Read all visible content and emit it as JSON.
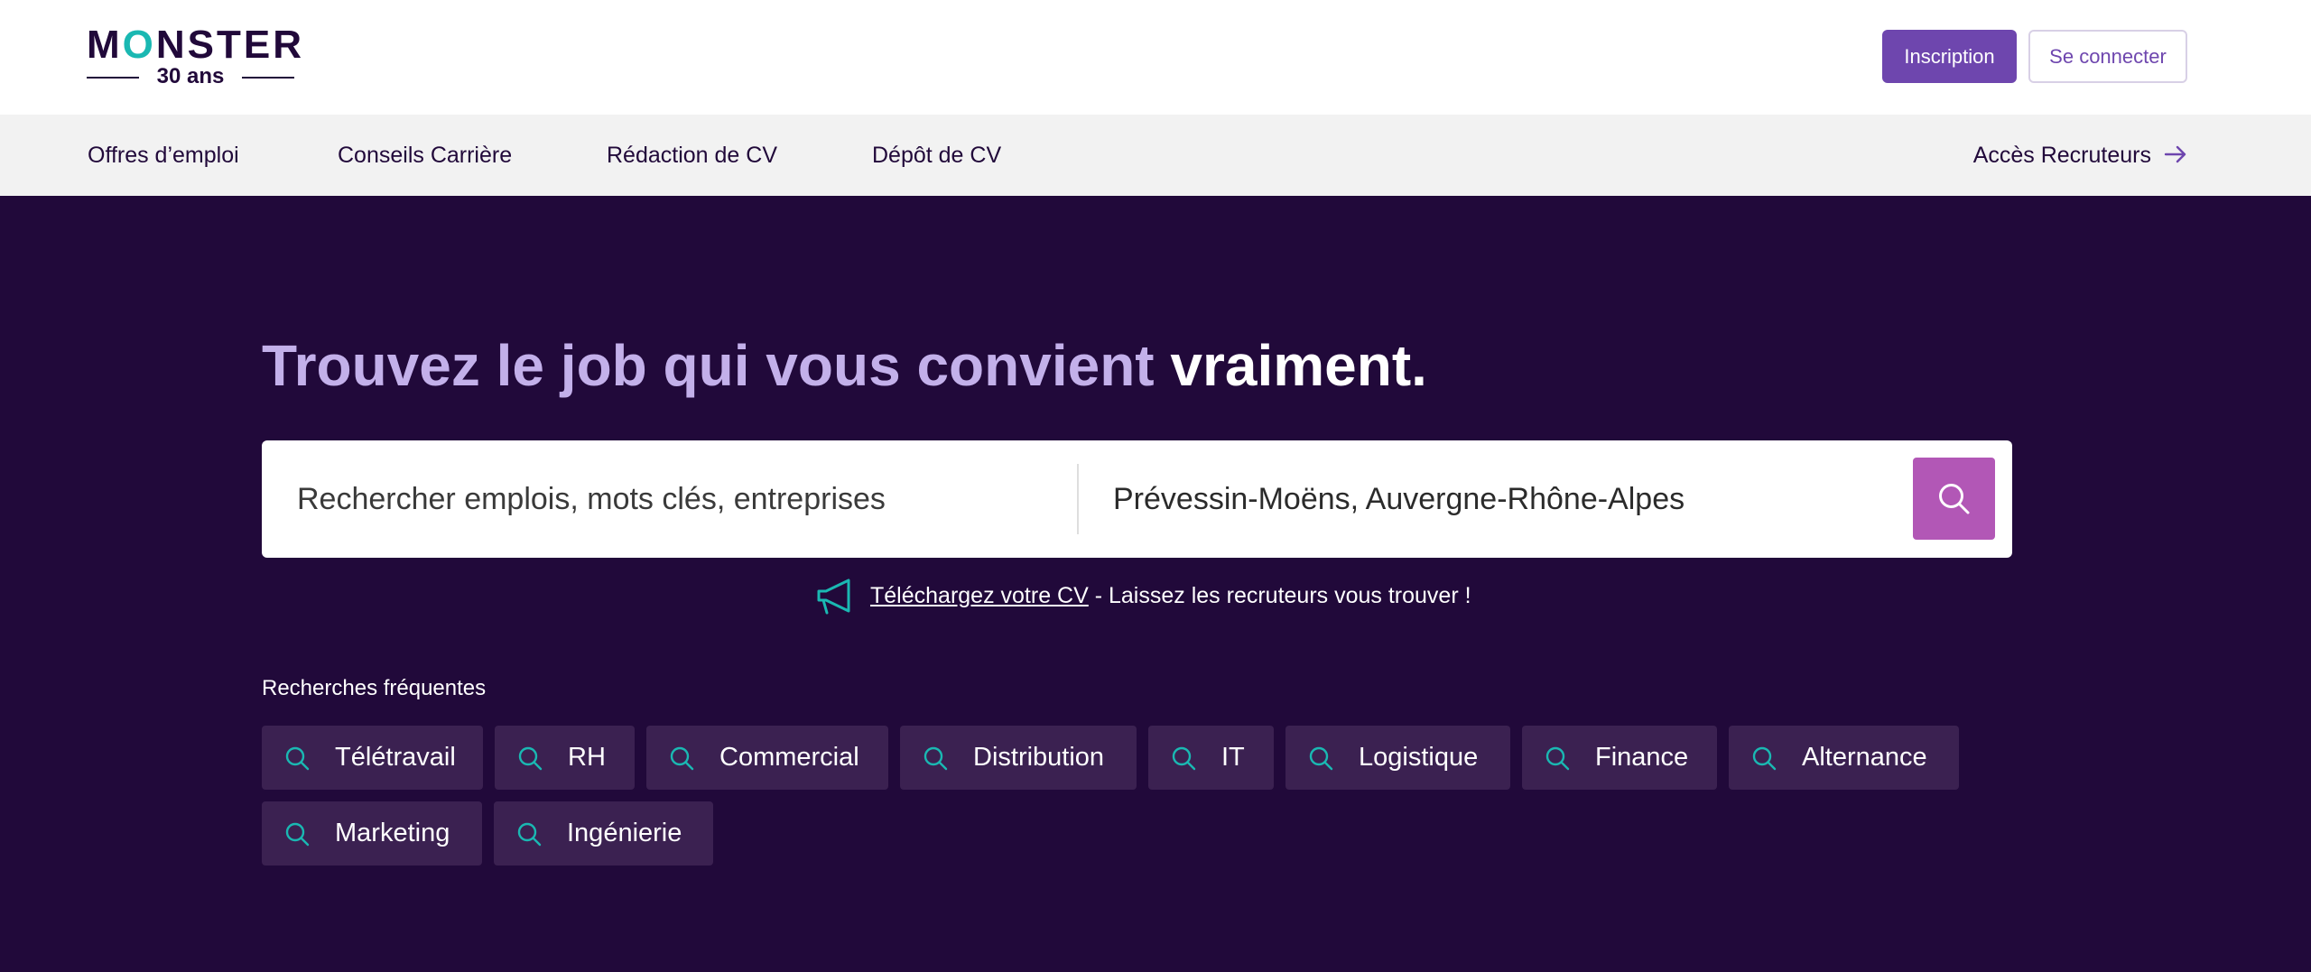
{
  "brand": {
    "name_pre": "M",
    "name_o": "O",
    "name_post": "NSTER",
    "tagline": "30 ans",
    "colors": {
      "dark_purple": "#21093a",
      "accent_purple": "#6e46ae",
      "teal": "#1ab8b2",
      "search_button": "#b257b6",
      "headline_light": "#c3b0ea"
    }
  },
  "header": {
    "signup_label": "Inscription",
    "login_label": "Se connecter"
  },
  "nav": {
    "items": [
      {
        "label": "Offres d’emploi"
      },
      {
        "label": "Conseils Carrière"
      },
      {
        "label": "Rédaction de CV"
      },
      {
        "label": "Dépôt de CV"
      }
    ],
    "recruiters_label": "Accès Recruteurs",
    "recruiters_icon": "arrow-right-icon"
  },
  "hero": {
    "headline_light": "Trouvez le job qui vous convient ",
    "headline_strong": "vraiment."
  },
  "search": {
    "keywords_placeholder": "Rechercher emplois, mots clés, entreprises",
    "location_value": "Prévessin-Moëns, Auvergne-Rhône-Alpes",
    "button_icon": "search-icon"
  },
  "cv_promo": {
    "icon": "megaphone-icon",
    "link_text": "Téléchargez votre CV",
    "rest_text": " - Laissez les recruteurs vous trouver !"
  },
  "frequent": {
    "label": "Recherches fréquentes",
    "chips": [
      {
        "label": "Télétravail"
      },
      {
        "label": "RH"
      },
      {
        "label": "Commercial"
      },
      {
        "label": "Distribution"
      },
      {
        "label": "IT"
      },
      {
        "label": "Logistique"
      },
      {
        "label": "Finance"
      },
      {
        "label": "Alternance"
      },
      {
        "label": "Marketing"
      },
      {
        "label": "Ingénierie"
      }
    ]
  }
}
